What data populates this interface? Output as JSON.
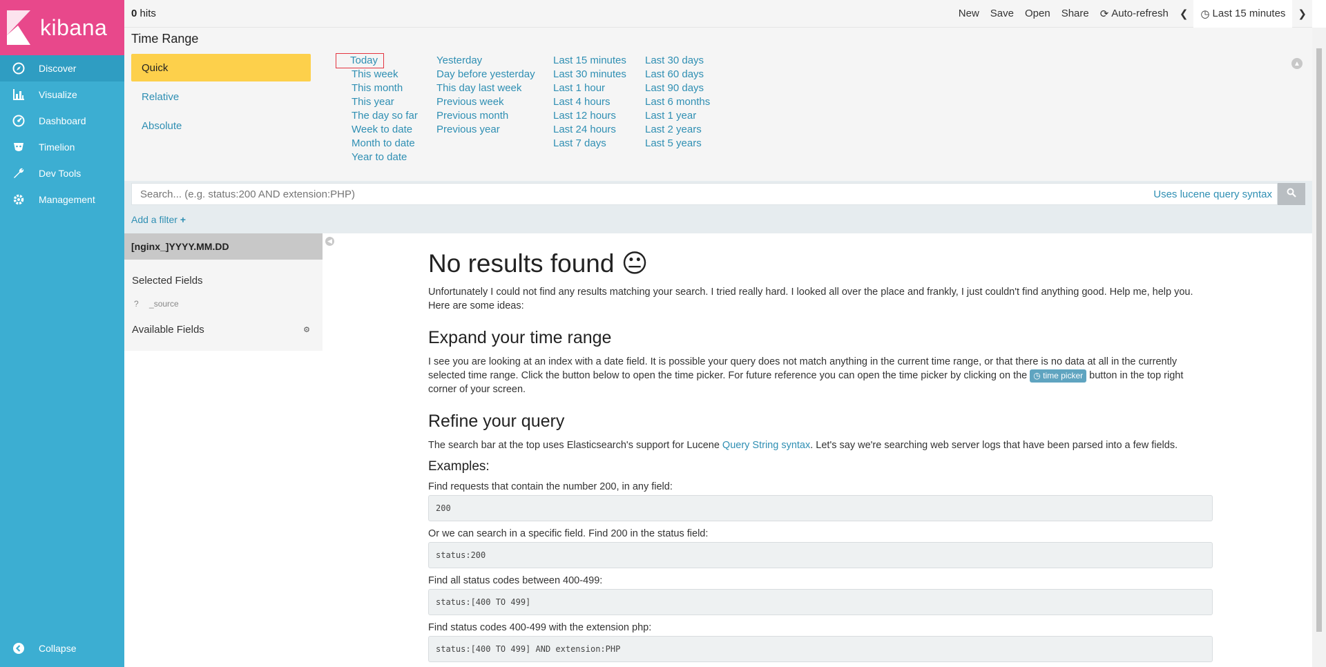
{
  "brand": {
    "name": "kibana",
    "colors": {
      "sidebar": "#3caed2",
      "brand": "#e8488b",
      "active_tab": "#fdd04b",
      "link": "#2f8fb3"
    }
  },
  "nav": {
    "items": [
      {
        "label": "Discover",
        "icon": "compass-icon"
      },
      {
        "label": "Visualize",
        "icon": "bar-chart-icon"
      },
      {
        "label": "Dashboard",
        "icon": "dashboard-icon"
      },
      {
        "label": "Timelion",
        "icon": "timelion-icon"
      },
      {
        "label": "Dev Tools",
        "icon": "wrench-icon"
      },
      {
        "label": "Management",
        "icon": "gear-icon"
      }
    ],
    "collapse_label": "Collapse"
  },
  "topbar": {
    "hits_count": "0",
    "hits_label": "hits",
    "new_label": "New",
    "save_label": "Save",
    "open_label": "Open",
    "share_label": "Share",
    "autorefresh_label": "Auto-refresh",
    "timepicker_label": "Last 15 minutes"
  },
  "timerange": {
    "title": "Time Range",
    "modes": [
      "Quick",
      "Relative",
      "Absolute"
    ],
    "columns": [
      [
        "Today",
        "This week",
        "This month",
        "This year",
        "The day so far",
        "Week to date",
        "Month to date",
        "Year to date"
      ],
      [
        "Yesterday",
        "Day before yesterday",
        "This day last week",
        "Previous week",
        "Previous month",
        "Previous year"
      ],
      [
        "Last 15 minutes",
        "Last 30 minutes",
        "Last 1 hour",
        "Last 4 hours",
        "Last 12 hours",
        "Last 24 hours",
        "Last 7 days"
      ],
      [
        "Last 30 days",
        "Last 60 days",
        "Last 90 days",
        "Last 6 months",
        "Last 1 year",
        "Last 2 years",
        "Last 5 years"
      ]
    ]
  },
  "search": {
    "placeholder": "Search... (e.g. status:200 AND extension:PHP)",
    "lucene_label": "Uses lucene query syntax"
  },
  "filter": {
    "add_label": "Add a filter"
  },
  "fields": {
    "index_pattern": "[nginx_]YYYY.MM.DD",
    "selected_title": "Selected Fields",
    "source_type": "?",
    "source_name": "_source",
    "available_title": "Available Fields"
  },
  "main": {
    "no_results": "No results found",
    "no_results_emoji": "😐",
    "intro": "Unfortunately I could not find any results matching your search. I tried really hard. I looked all over the place and frankly, I just couldn't find anything good. Help me, help you. Here are some ideas:",
    "expand_title": "Expand your time range",
    "expand_text_before": "I see you are looking at an index with a date field. It is possible your query does not match anything in the current time range, or that there is no data at all in the currently selected time range. Click the button below to open the time picker. For future reference you can open the time picker by clicking on the",
    "expand_badge": "time picker",
    "expand_text_after": "button in the top right corner of your screen.",
    "refine_title": "Refine your query",
    "refine_text_before": "The search bar at the top uses Elasticsearch's support for Lucene",
    "refine_link": "Query String syntax",
    "refine_text_after": ". Let's say we're searching web server logs that have been parsed into a few fields.",
    "examples_title": "Examples:",
    "examples": [
      {
        "label": "Find requests that contain the number 200, in any field:",
        "code": "200"
      },
      {
        "label": "Or we can search in a specific field. Find 200 in the status field:",
        "code": "status:200"
      },
      {
        "label": "Find all status codes between 400-499:",
        "code": "status:[400 TO 499]"
      },
      {
        "label": "Find status codes 400-499 with the extension php:",
        "code": "status:[400 TO 499] AND extension:PHP"
      }
    ]
  }
}
